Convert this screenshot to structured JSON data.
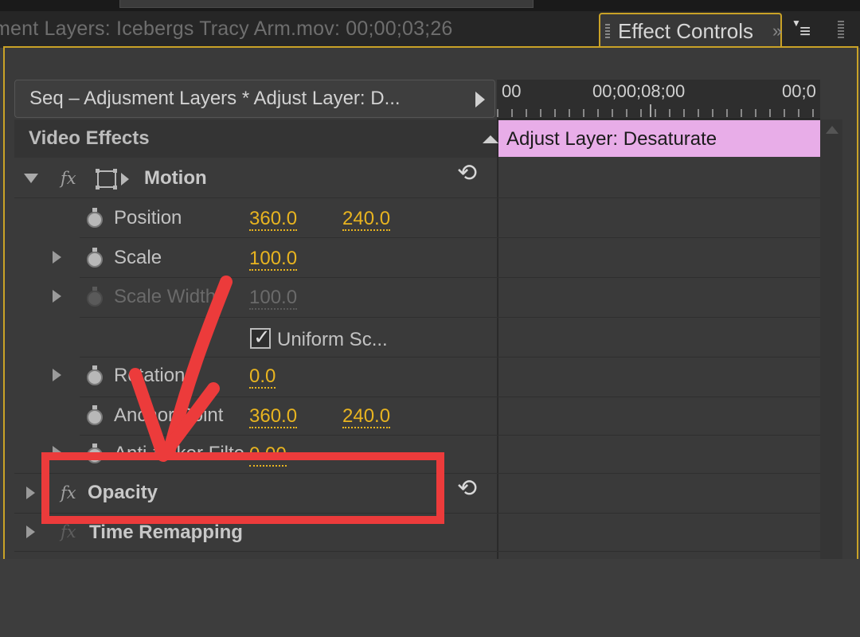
{
  "source_tab": {
    "title": "ment Layers: Icebergs Tracy Arm.mov: 00;00;03;26"
  },
  "active_tab": {
    "label": "Effect Controls",
    "overflow": "»"
  },
  "panel_menu_icon": "panel-menu-icon",
  "header": {
    "sequence_label": "Seq – Adjusment Layers * Adjust Layer: D..."
  },
  "timeline": {
    "ruler_labels": [
      "00",
      "00;00;08;00",
      "00;0"
    ],
    "clip_label": "Adjust Layer: Desaturate",
    "clip_color": "#e8ade8"
  },
  "section": {
    "title": "Video Effects"
  },
  "effects": {
    "motion": {
      "name": "Motion",
      "position": {
        "label": "Position",
        "x": "360.0",
        "y": "240.0"
      },
      "scale": {
        "label": "Scale",
        "value": "100.0"
      },
      "scale_width": {
        "label": "Scale Width",
        "value": "100.0"
      },
      "uniform_scale": {
        "label": "Uniform Sc...",
        "checked": true
      },
      "rotation": {
        "label": "Rotation",
        "value": "0.0"
      },
      "anchor_point": {
        "label": "Anchor Point",
        "x": "360.0",
        "y": "240.0"
      },
      "anti_flicker": {
        "label": "Anti-flicker Filter",
        "value": "0.00"
      }
    },
    "opacity": {
      "name": "Opacity"
    },
    "time_remapping": {
      "name": "Time Remapping"
    }
  },
  "colors": {
    "accent": "#c9a227",
    "value": "#e8b420",
    "highlight": "#ec3b3b"
  }
}
